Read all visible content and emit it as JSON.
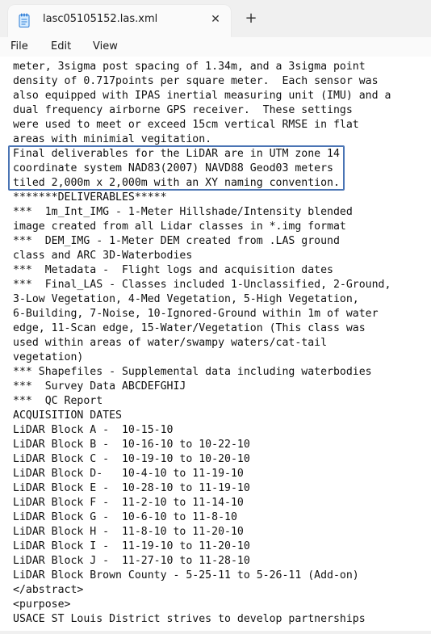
{
  "tab": {
    "title": "lasc05105152.las.xml",
    "close_glyph": "✕",
    "new_tab_glyph": "+",
    "icon": "notepad-icon"
  },
  "menu": {
    "file": "File",
    "edit": "Edit",
    "view": "View"
  },
  "highlight_color": "#4a74b4",
  "lines": [
    "meter, 3sigma post spacing of 1.34m, and a 3sigma point",
    "density of 0.717points per square meter.  Each sensor was",
    "also equipped with IPAS inertial measuring unit (IMU) and a",
    "dual frequency airborne GPS receiver.  These settings",
    "were used to meet or exceed 15cm vertical RMSE in flat",
    "areas with minimial vegitation.",
    "Final deliverables for the LiDAR are in UTM zone 14",
    "coordinate system NAD83(2007) NAVD88 Geod03 meters",
    "tiled 2,000m x 2,000m with an XY naming convention.",
    "*******DELIVERABLES*****",
    "***  1m_Int_IMG - 1-Meter Hillshade/Intensity blended",
    "image created from all Lidar classes in *.img format",
    "***  DEM_IMG - 1-Meter DEM created from .LAS ground",
    "class and ARC 3D-Waterbodies",
    "***  Metadata -  Flight logs and acquisition dates",
    "***  Final_LAS - Classes included 1-Unclassified, 2-Ground,",
    "3-Low Vegetation, 4-Med Vegetation, 5-High Vegetation,",
    "6-Building, 7-Noise, 10-Ignored-Ground within 1m of water",
    "edge, 11-Scan edge, 15-Water/Vegetation (This class was",
    "used within areas of water/swampy waters/cat-tail",
    "vegetation)",
    "*** Shapefiles - Supplemental data including waterbodies",
    "***  Survey Data ABCDEFGHIJ",
    "***  QC Report",
    "ACQUISITION DATES",
    "LiDAR Block A -  10-15-10",
    "LiDAR Block B -  10-16-10 to 10-22-10",
    "LiDAR Block C -  10-19-10 to 10-20-10",
    "LiDAR Block D-   10-4-10 to 11-19-10",
    "LiDAR Block E -  10-28-10 to 11-19-10",
    "LiDAR Block F -  11-2-10 to 11-14-10",
    "LiDAR Block G -  10-6-10 to 11-8-10",
    "LiDAR Block H -  11-8-10 to 11-20-10",
    "LiDAR Block I -  11-19-10 to 11-20-10",
    "LiDAR Block J -  11-27-10 to 11-28-10",
    "LiDAR Block Brown County - 5-25-11 to 5-26-11 (Add-on)",
    "</abstract>",
    "<purpose>",
    "USACE ST Louis District strives to develop partnerships"
  ]
}
